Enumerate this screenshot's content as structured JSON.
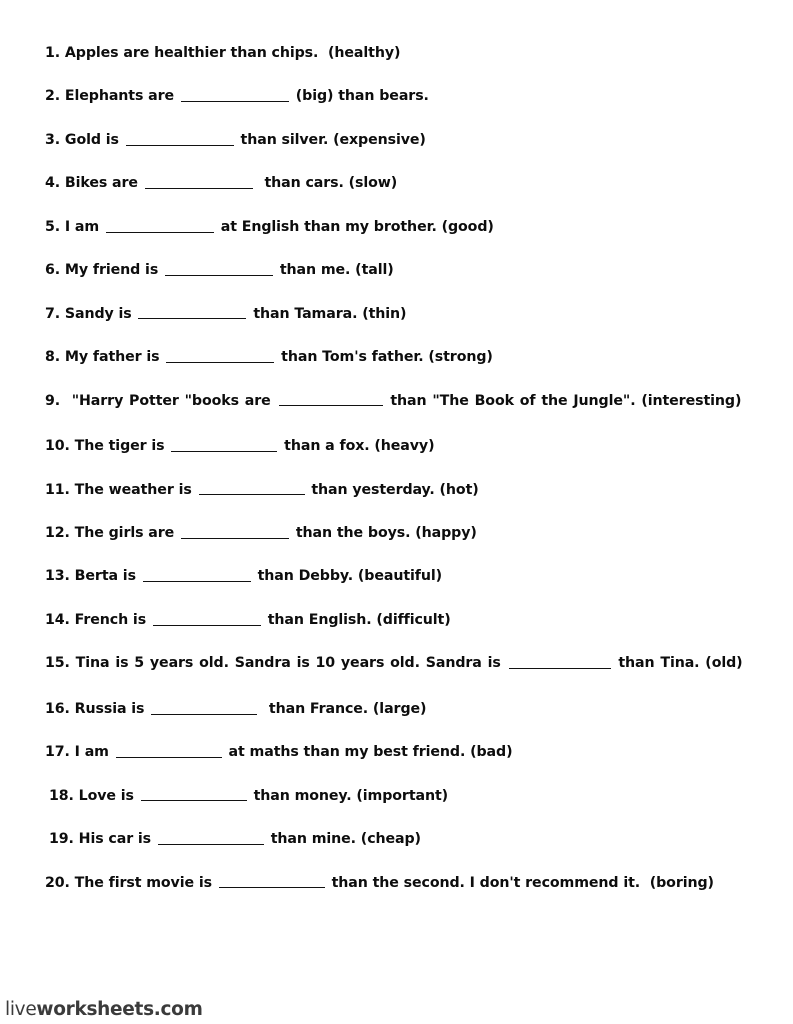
{
  "document": {
    "title": "Comparatives Worksheet",
    "background_color": "#ffffff",
    "text_color": "#0d0d0d"
  },
  "watermark": {
    "light_part": "live",
    "bold_part": "worksheets.com",
    "full_text": "liveworksheets.com",
    "color": "#3b3b3b"
  },
  "exercises": [
    {
      "number": "1.",
      "before": " Apples are healthier than chips.  (healthy)",
      "blank": false,
      "blank_width": 0,
      "after": "",
      "full_text": "1. Apples are healthier than chips.  (healthy)"
    },
    {
      "number": "2.",
      "before": " Elephants are ",
      "blank": true,
      "blank_width": 108,
      "after": " (big) than bears.",
      "full_text": "2. Elephants are _______________ (big) than bears."
    },
    {
      "number": "3.",
      "before": " Gold is ",
      "blank": true,
      "blank_width": 108,
      "after": " than silver. (expensive)",
      "full_text": "3. Gold is _______________ than silver. (expensive)"
    },
    {
      "number": "4.",
      "before": " Bikes are ",
      "blank": true,
      "blank_width": 108,
      "after": "  than cars. (slow)",
      "full_text": "4. Bikes are _______________  than cars. (slow)"
    },
    {
      "number": "5.",
      "before": " I am ",
      "blank": true,
      "blank_width": 108,
      "after": " at English than my brother. (good)",
      "full_text": "5. I am _______________ at English than my brother. (good)"
    },
    {
      "number": "6.",
      "before": " My friend is ",
      "blank": true,
      "blank_width": 108,
      "after": " than me. (tall)",
      "full_text": "6. My friend is _______________ than me. (tall)"
    },
    {
      "number": "7.",
      "before": " Sandy is ",
      "blank": true,
      "blank_width": 108,
      "after": " than Tamara. (thin)",
      "full_text": "7. Sandy is _______________ than Tamara. (thin)"
    },
    {
      "number": "8.",
      "before": " My father is ",
      "blank": true,
      "blank_width": 108,
      "after": " than Tom's father. (strong)",
      "full_text": "8. My father is _______________ than Tom's father. (strong)"
    },
    {
      "number": "9.",
      "before": "  \"Harry Potter \"books are ",
      "blank": true,
      "blank_width": 104,
      "after": " than \"The Book of the Jungle\". (interesting)",
      "full_text": "9.  \"Harry Potter \"books are _______________ than \"The Book of the Jungle\". (interesting)"
    },
    {
      "number": "10.",
      "before": " The tiger is ",
      "blank": true,
      "blank_width": 106,
      "after": " than a fox. (heavy)",
      "full_text": "10. The tiger is _______________ than a fox. (heavy)"
    },
    {
      "number": "11.",
      "before": " The weather is ",
      "blank": true,
      "blank_width": 106,
      "after": " than yesterday. (hot)",
      "full_text": "11. The weather is _______________ than yesterday. (hot)"
    },
    {
      "number": "12.",
      "before": " The girls are ",
      "blank": true,
      "blank_width": 108,
      "after": " than the boys. (happy)",
      "full_text": "12. The girls are _______________ than the boys. (happy)"
    },
    {
      "number": "13.",
      "before": " Berta is ",
      "blank": true,
      "blank_width": 108,
      "after": " than Debby. (beautiful)",
      "full_text": "13. Berta is _______________ than Debby. (beautiful)"
    },
    {
      "number": "14.",
      "before": " French is ",
      "blank": true,
      "blank_width": 108,
      "after": " than English. (difficult)",
      "full_text": "14. French is _______________ than English. (difficult)"
    },
    {
      "number": "15.",
      "before": " Tina is 5 years old. Sandra is 10 years old. Sandra is ",
      "blank": true,
      "blank_width": 102,
      "after": " than Tina. (old)",
      "full_text": "15. Tina is 5 years old. Sandra is 10 years old. Sandra is _______________ than Tina. (old)"
    },
    {
      "number": "16.",
      "before": " Russia is ",
      "blank": true,
      "blank_width": 106,
      "after": "  than France. (large)",
      "full_text": "16. Russia is _______________  than France. (large)"
    },
    {
      "number": "17.",
      "before": " I am ",
      "blank": true,
      "blank_width": 106,
      "after": " at maths than my best friend. (bad)",
      "full_text": "17. I am _______________ at maths than my best friend. (bad)"
    },
    {
      "number": "18.",
      "before": " Love is ",
      "blank": true,
      "blank_width": 106,
      "after": " than money. (important)",
      "full_text": "18. Love is _______________ than money. (important)"
    },
    {
      "number": "19.",
      "before": " His car is ",
      "blank": true,
      "blank_width": 106,
      "after": " than mine. (cheap)",
      "full_text": "19. His car is _______________ than mine. (cheap)"
    },
    {
      "number": "20.",
      "before": " The first movie is ",
      "blank": true,
      "blank_width": 106,
      "after": " than the second. I don't recommend it.  (boring)",
      "full_text": "20. The first movie is _______________ than the second. I don't recommend it.  (boring)"
    }
  ]
}
